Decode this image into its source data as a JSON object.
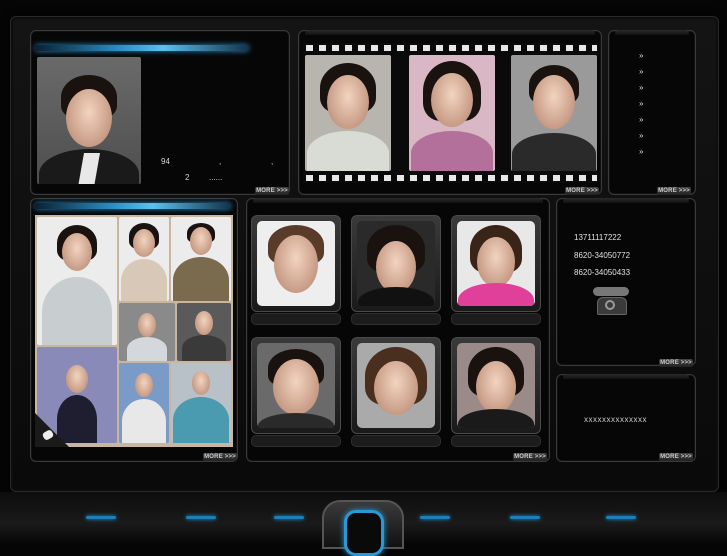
{
  "featured": {
    "line1": "94",
    "line1_tail": ",",
    "line1_end": ",",
    "line2": "2",
    "line2_tail": "......"
  },
  "more_label": "MORE >>>",
  "contact": {
    "mobile": "13711117222",
    "phone1": "8620-34050772",
    "phone2": "8620-34050433"
  },
  "notice": {
    "text": "xxxxxxxxxxxxxx"
  },
  "news_list": [
    "»",
    "»",
    "»",
    "»",
    "»",
    "»",
    "»"
  ],
  "icons": {
    "telephone": "telephone-icon",
    "spotlight": "spotlight-icon"
  },
  "colors": {
    "accent_blue": "#2c9ad6",
    "background": "#050505"
  }
}
